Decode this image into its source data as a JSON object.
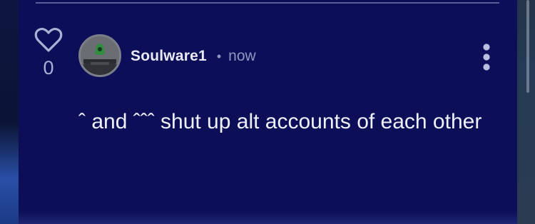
{
  "post": {
    "username": "Soulware1",
    "separator": "•",
    "timestamp": "now",
    "like_count": "0",
    "comment_text": "ˆ and ˆˆˆ shut up alt accounts of each other",
    "icons": {
      "like": "heart-outline-icon",
      "more": "vertical-ellipsis-icon"
    }
  },
  "colors": {
    "panel_bg": "#0c0f57",
    "username": "#e8eaf7",
    "muted": "#9096c2",
    "text": "#eef0fb"
  }
}
